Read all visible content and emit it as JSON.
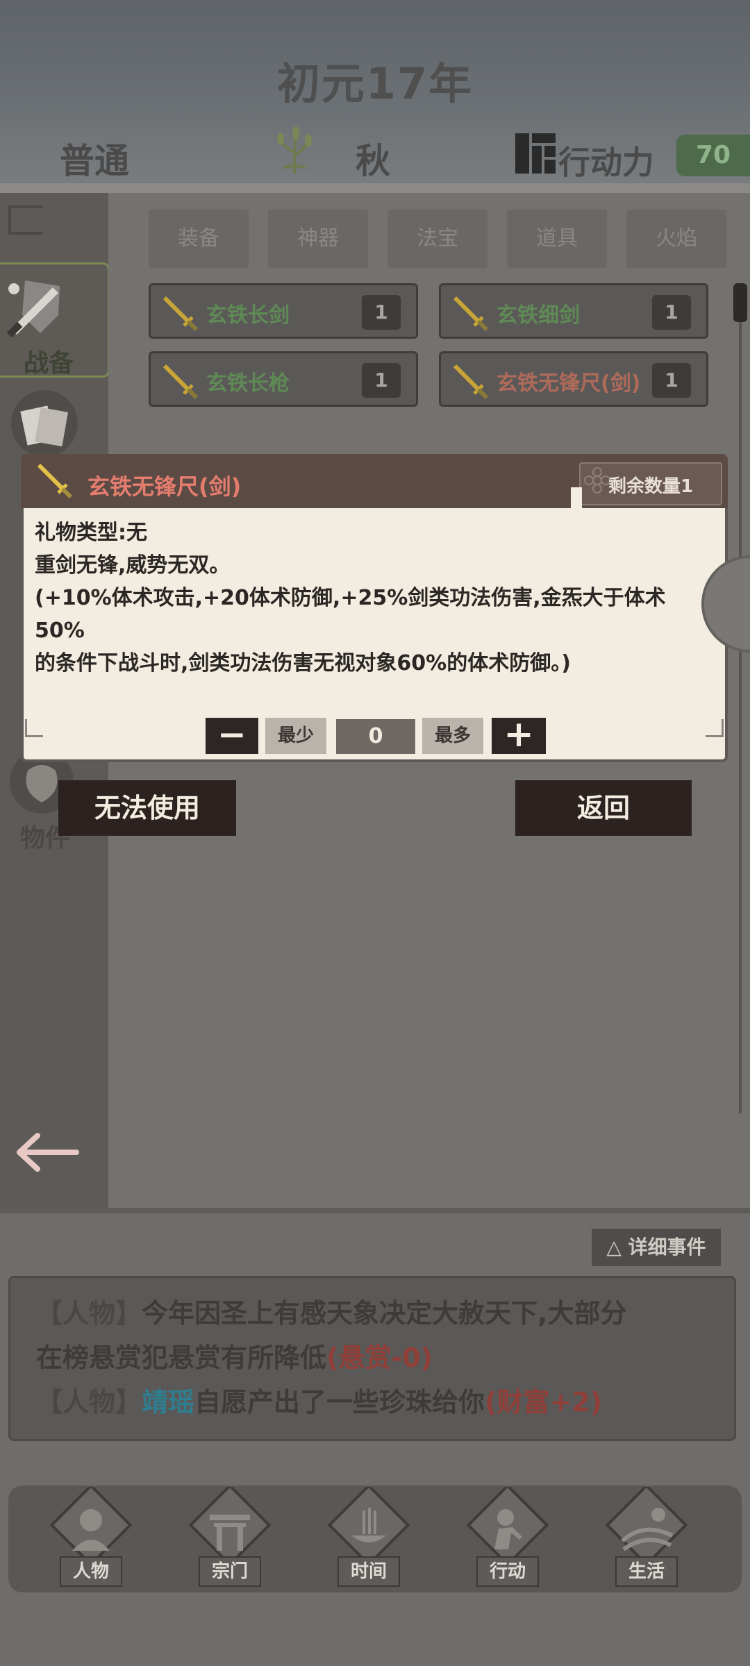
{
  "header": {
    "title": "初元17年",
    "difficulty": "普通",
    "season": "秋",
    "action_points_label": "行动力",
    "action_points_value": "70"
  },
  "left_rail": {
    "active_label": "战备",
    "bag_label": "物件"
  },
  "tabs": [
    {
      "label": "装备"
    },
    {
      "label": "神器"
    },
    {
      "label": "法宝"
    },
    {
      "label": "道具"
    },
    {
      "label": "火焰"
    }
  ],
  "items": [
    {
      "name": "玄铁长剑",
      "count": "1",
      "color": "#5f8a55"
    },
    {
      "name": "玄铁细剑",
      "count": "1",
      "color": "#5f8a55"
    },
    {
      "name": "玄铁长枪",
      "count": "1",
      "color": "#5f8a55"
    },
    {
      "name": "玄铁无锋尺(剑)",
      "count": "1",
      "color": "#b06a5a"
    }
  ],
  "dialog": {
    "item_name": "玄铁无锋尺(剑)",
    "remaining": "剩余数量1",
    "gift_type": "礼物类型:无",
    "flavor": "重剑无锋,威势无双。",
    "effect_line1": "(+10%体术攻击,+20体术防御,+25%剑类功法伤害,金炁大于体术50%",
    "effect_line2": "的条件下战斗时,剑类功法伤害无视对象60%的体术防御。)",
    "minus": "−",
    "min_label": "最少",
    "quantity": "0",
    "max_label": "最多",
    "plus": "+"
  },
  "actions": {
    "cannot_use": "无法使用",
    "back": "返回"
  },
  "events": {
    "detail_button": "△ 详细事件",
    "line1_tag": "【人物】",
    "line1_text": "今年因圣上有感天象决定大赦天下,大部分",
    "line2_text": "在榜悬赏犯悬赏有所降低",
    "line2_effect": "(悬赏-0)",
    "line3_tag": "【人物】",
    "line3_name": "靖瑶",
    "line3_text": "自愿产出了一些珍珠给你",
    "line3_effect": "(财富+2)"
  },
  "nav": [
    {
      "label": "人物",
      "icon": "person-icon"
    },
    {
      "label": "宗门",
      "icon": "sect-gate-icon"
    },
    {
      "label": "时间",
      "icon": "incense-icon"
    },
    {
      "label": "行动",
      "icon": "action-icon"
    },
    {
      "label": "生活",
      "icon": "landscape-icon"
    }
  ],
  "colors": {
    "accent_green": "#5f8a55",
    "rare_red": "#b06a5a",
    "dialog_bg": "#f2ede0",
    "button_dark": "#2c2220"
  }
}
